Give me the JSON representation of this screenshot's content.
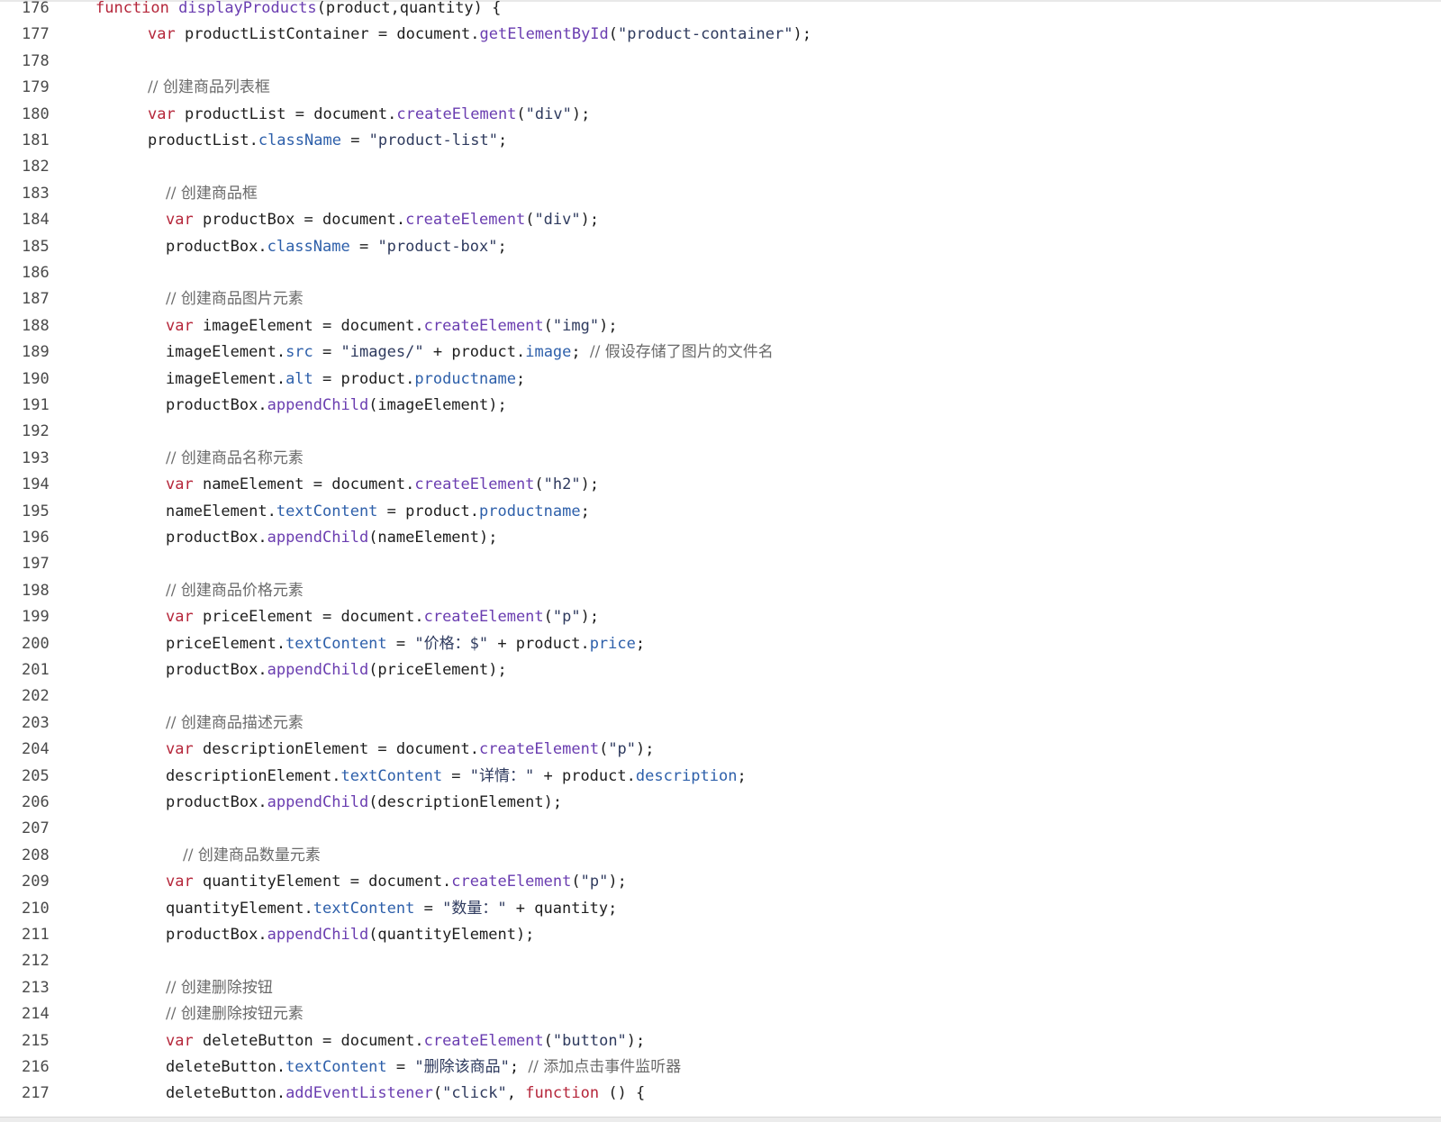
{
  "editor": {
    "colors": {
      "keyword": "#b5263a",
      "function": "#6a3db0",
      "property": "#2d5faa",
      "string": "#2e3a5e",
      "comment": "#6a6a6a",
      "plain": "#1e1e1e",
      "line_number": "#4a4a4a",
      "background": "#ffffff"
    },
    "lines": [
      {
        "number": "176",
        "indent": 1,
        "tokens": [
          {
            "t": "kw",
            "v": "function"
          },
          {
            "t": "plain",
            "v": " "
          },
          {
            "t": "fn",
            "v": "displayProducts"
          },
          {
            "t": "plain",
            "v": "(product,quantity) {"
          }
        ]
      },
      {
        "number": "177",
        "indent": 2,
        "tokens": [
          {
            "t": "kw",
            "v": "var"
          },
          {
            "t": "plain",
            "v": " productListContainer = document."
          },
          {
            "t": "fn",
            "v": "getElementById"
          },
          {
            "t": "plain",
            "v": "("
          },
          {
            "t": "str",
            "v": "\"product-container\""
          },
          {
            "t": "plain",
            "v": ");"
          }
        ]
      },
      {
        "number": "178",
        "indent": 2,
        "tokens": []
      },
      {
        "number": "179",
        "indent": 2,
        "tokens": [
          {
            "t": "cm",
            "v": "// 创建商品列表框"
          }
        ]
      },
      {
        "number": "180",
        "indent": 2,
        "tokens": [
          {
            "t": "kw",
            "v": "var"
          },
          {
            "t": "plain",
            "v": " productList = document."
          },
          {
            "t": "fn",
            "v": "createElement"
          },
          {
            "t": "plain",
            "v": "("
          },
          {
            "t": "str",
            "v": "\"div\""
          },
          {
            "t": "plain",
            "v": ");"
          }
        ]
      },
      {
        "number": "181",
        "indent": 2,
        "tokens": [
          {
            "t": "plain",
            "v": "productList."
          },
          {
            "t": "prop",
            "v": "className"
          },
          {
            "t": "plain",
            "v": " = "
          },
          {
            "t": "str",
            "v": "\"product-list\""
          },
          {
            "t": "plain",
            "v": ";"
          }
        ]
      },
      {
        "number": "182",
        "indent": 2,
        "tokens": []
      },
      {
        "number": "183",
        "indent": 3,
        "tokens": [
          {
            "t": "cm",
            "v": "// 创建商品框"
          }
        ]
      },
      {
        "number": "184",
        "indent": 3,
        "tokens": [
          {
            "t": "kw",
            "v": "var"
          },
          {
            "t": "plain",
            "v": " productBox = document."
          },
          {
            "t": "fn",
            "v": "createElement"
          },
          {
            "t": "plain",
            "v": "("
          },
          {
            "t": "str",
            "v": "\"div\""
          },
          {
            "t": "plain",
            "v": ");"
          }
        ]
      },
      {
        "number": "185",
        "indent": 3,
        "tokens": [
          {
            "t": "plain",
            "v": "productBox."
          },
          {
            "t": "prop",
            "v": "className"
          },
          {
            "t": "plain",
            "v": " = "
          },
          {
            "t": "str",
            "v": "\"product-box\""
          },
          {
            "t": "plain",
            "v": ";"
          }
        ]
      },
      {
        "number": "186",
        "indent": 3,
        "tokens": []
      },
      {
        "number": "187",
        "indent": 3,
        "tokens": [
          {
            "t": "cm",
            "v": "// 创建商品图片元素"
          }
        ]
      },
      {
        "number": "188",
        "indent": 3,
        "tokens": [
          {
            "t": "kw",
            "v": "var"
          },
          {
            "t": "plain",
            "v": " imageElement = document."
          },
          {
            "t": "fn",
            "v": "createElement"
          },
          {
            "t": "plain",
            "v": "("
          },
          {
            "t": "str",
            "v": "\"img\""
          },
          {
            "t": "plain",
            "v": ");"
          }
        ]
      },
      {
        "number": "189",
        "indent": 3,
        "tokens": [
          {
            "t": "plain",
            "v": "imageElement."
          },
          {
            "t": "prop",
            "v": "src"
          },
          {
            "t": "plain",
            "v": " = "
          },
          {
            "t": "str",
            "v": "\"images/\""
          },
          {
            "t": "plain",
            "v": " + product."
          },
          {
            "t": "prop",
            "v": "image"
          },
          {
            "t": "plain",
            "v": "; "
          },
          {
            "t": "cm",
            "v": "// 假设存储了图片的文件名"
          }
        ]
      },
      {
        "number": "190",
        "indent": 3,
        "tokens": [
          {
            "t": "plain",
            "v": "imageElement."
          },
          {
            "t": "prop",
            "v": "alt"
          },
          {
            "t": "plain",
            "v": " = product."
          },
          {
            "t": "prop",
            "v": "productname"
          },
          {
            "t": "plain",
            "v": ";"
          }
        ]
      },
      {
        "number": "191",
        "indent": 3,
        "tokens": [
          {
            "t": "plain",
            "v": "productBox."
          },
          {
            "t": "fn",
            "v": "appendChild"
          },
          {
            "t": "plain",
            "v": "(imageElement);"
          }
        ]
      },
      {
        "number": "192",
        "indent": 3,
        "tokens": []
      },
      {
        "number": "193",
        "indent": 3,
        "tokens": [
          {
            "t": "cm",
            "v": "// 创建商品名称元素"
          }
        ]
      },
      {
        "number": "194",
        "indent": 3,
        "tokens": [
          {
            "t": "kw",
            "v": "var"
          },
          {
            "t": "plain",
            "v": " nameElement = document."
          },
          {
            "t": "fn",
            "v": "createElement"
          },
          {
            "t": "plain",
            "v": "("
          },
          {
            "t": "str",
            "v": "\"h2\""
          },
          {
            "t": "plain",
            "v": ");"
          }
        ]
      },
      {
        "number": "195",
        "indent": 3,
        "tokens": [
          {
            "t": "plain",
            "v": "nameElement."
          },
          {
            "t": "prop",
            "v": "textContent"
          },
          {
            "t": "plain",
            "v": " = product."
          },
          {
            "t": "prop",
            "v": "productname"
          },
          {
            "t": "plain",
            "v": ";"
          }
        ]
      },
      {
        "number": "196",
        "indent": 3,
        "tokens": [
          {
            "t": "plain",
            "v": "productBox."
          },
          {
            "t": "fn",
            "v": "appendChild"
          },
          {
            "t": "plain",
            "v": "(nameElement);"
          }
        ]
      },
      {
        "number": "197",
        "indent": 3,
        "tokens": []
      },
      {
        "number": "198",
        "indent": 3,
        "tokens": [
          {
            "t": "cm",
            "v": "// 创建商品价格元素"
          }
        ]
      },
      {
        "number": "199",
        "indent": 3,
        "tokens": [
          {
            "t": "kw",
            "v": "var"
          },
          {
            "t": "plain",
            "v": " priceElement = document."
          },
          {
            "t": "fn",
            "v": "createElement"
          },
          {
            "t": "plain",
            "v": "("
          },
          {
            "t": "str",
            "v": "\"p\""
          },
          {
            "t": "plain",
            "v": ");"
          }
        ]
      },
      {
        "number": "200",
        "indent": 3,
        "tokens": [
          {
            "t": "plain",
            "v": "priceElement."
          },
          {
            "t": "prop",
            "v": "textContent"
          },
          {
            "t": "plain",
            "v": " = "
          },
          {
            "t": "str",
            "v": "\"价格：$\""
          },
          {
            "t": "plain",
            "v": " + product."
          },
          {
            "t": "prop",
            "v": "price"
          },
          {
            "t": "plain",
            "v": ";"
          }
        ]
      },
      {
        "number": "201",
        "indent": 3,
        "tokens": [
          {
            "t": "plain",
            "v": "productBox."
          },
          {
            "t": "fn",
            "v": "appendChild"
          },
          {
            "t": "plain",
            "v": "(priceElement);"
          }
        ]
      },
      {
        "number": "202",
        "indent": 3,
        "tokens": []
      },
      {
        "number": "203",
        "indent": 3,
        "tokens": [
          {
            "t": "cm",
            "v": "// 创建商品描述元素"
          }
        ]
      },
      {
        "number": "204",
        "indent": 3,
        "tokens": [
          {
            "t": "kw",
            "v": "var"
          },
          {
            "t": "plain",
            "v": " descriptionElement = document."
          },
          {
            "t": "fn",
            "v": "createElement"
          },
          {
            "t": "plain",
            "v": "("
          },
          {
            "t": "str",
            "v": "\"p\""
          },
          {
            "t": "plain",
            "v": ");"
          }
        ]
      },
      {
        "number": "205",
        "indent": 3,
        "tokens": [
          {
            "t": "plain",
            "v": "descriptionElement."
          },
          {
            "t": "prop",
            "v": "textContent"
          },
          {
            "t": "plain",
            "v": " = "
          },
          {
            "t": "str",
            "v": "\"详情：\""
          },
          {
            "t": "plain",
            "v": " + product."
          },
          {
            "t": "prop",
            "v": "description"
          },
          {
            "t": "plain",
            "v": ";"
          }
        ]
      },
      {
        "number": "206",
        "indent": 3,
        "tokens": [
          {
            "t": "plain",
            "v": "productBox."
          },
          {
            "t": "fn",
            "v": "appendChild"
          },
          {
            "t": "plain",
            "v": "(descriptionElement);"
          }
        ]
      },
      {
        "number": "207",
        "indent": 3,
        "tokens": []
      },
      {
        "number": "208",
        "indent": 4,
        "tokens": [
          {
            "t": "cm",
            "v": "// 创建商品数量元素"
          }
        ]
      },
      {
        "number": "209",
        "indent": 3,
        "tokens": [
          {
            "t": "kw",
            "v": "var"
          },
          {
            "t": "plain",
            "v": " quantityElement = document."
          },
          {
            "t": "fn",
            "v": "createElement"
          },
          {
            "t": "plain",
            "v": "("
          },
          {
            "t": "str",
            "v": "\"p\""
          },
          {
            "t": "plain",
            "v": ");"
          }
        ]
      },
      {
        "number": "210",
        "indent": 3,
        "tokens": [
          {
            "t": "plain",
            "v": "quantityElement."
          },
          {
            "t": "prop",
            "v": "textContent"
          },
          {
            "t": "plain",
            "v": " = "
          },
          {
            "t": "str",
            "v": "\"数量：\""
          },
          {
            "t": "plain",
            "v": " + quantity;"
          }
        ]
      },
      {
        "number": "211",
        "indent": 3,
        "tokens": [
          {
            "t": "plain",
            "v": "productBox."
          },
          {
            "t": "fn",
            "v": "appendChild"
          },
          {
            "t": "plain",
            "v": "(quantityElement);"
          }
        ]
      },
      {
        "number": "212",
        "indent": 3,
        "tokens": []
      },
      {
        "number": "213",
        "indent": 3,
        "tokens": [
          {
            "t": "cm",
            "v": "// 创建删除按钮"
          }
        ]
      },
      {
        "number": "214",
        "indent": 3,
        "tokens": [
          {
            "t": "cm",
            "v": "// 创建删除按钮元素"
          }
        ]
      },
      {
        "number": "215",
        "indent": 3,
        "tokens": [
          {
            "t": "kw",
            "v": "var"
          },
          {
            "t": "plain",
            "v": " deleteButton = document."
          },
          {
            "t": "fn",
            "v": "createElement"
          },
          {
            "t": "plain",
            "v": "("
          },
          {
            "t": "str",
            "v": "\"button\""
          },
          {
            "t": "plain",
            "v": ");"
          }
        ]
      },
      {
        "number": "216",
        "indent": 3,
        "tokens": [
          {
            "t": "plain",
            "v": "deleteButton."
          },
          {
            "t": "prop",
            "v": "textContent"
          },
          {
            "t": "plain",
            "v": " = "
          },
          {
            "t": "str",
            "v": "\"删除该商品\""
          },
          {
            "t": "plain",
            "v": "; "
          },
          {
            "t": "cm",
            "v": "// 添加点击事件监听器"
          }
        ]
      },
      {
        "number": "217",
        "indent": 3,
        "tokens": [
          {
            "t": "plain",
            "v": "deleteButton."
          },
          {
            "t": "fn",
            "v": "addEventListener"
          },
          {
            "t": "plain",
            "v": "("
          },
          {
            "t": "str",
            "v": "\"click\""
          },
          {
            "t": "plain",
            "v": ", "
          },
          {
            "t": "kw",
            "v": "function"
          },
          {
            "t": "plain",
            "v": " () {"
          }
        ]
      }
    ]
  }
}
